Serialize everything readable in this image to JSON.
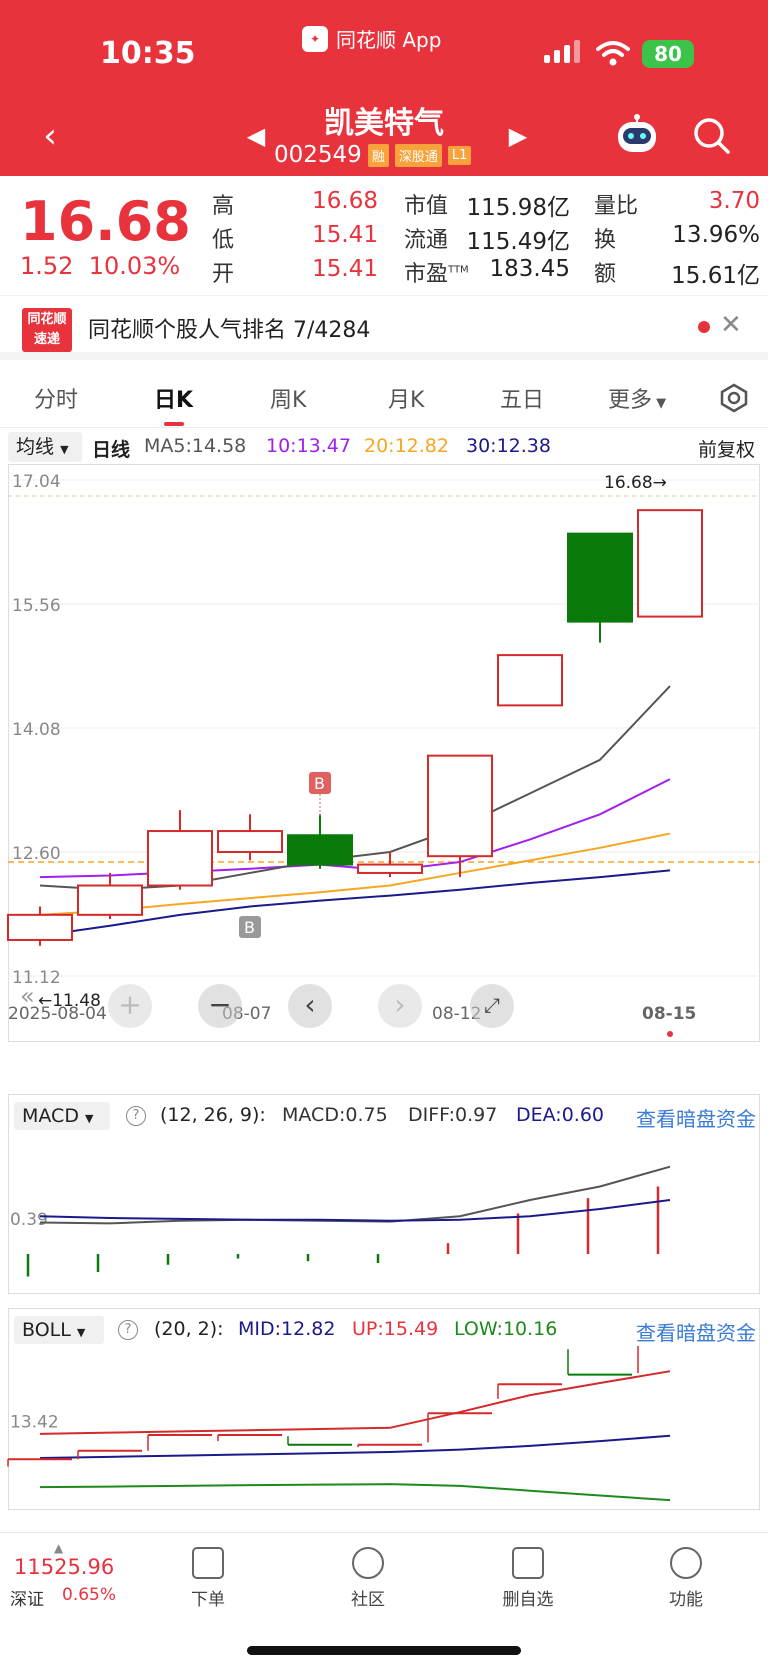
{
  "status": {
    "time": "10:35",
    "app": "同花顺 App",
    "battery": "80"
  },
  "header": {
    "stock_name": "凯美特气",
    "stock_code": "002549",
    "tags": [
      "融",
      "深股通",
      "L1"
    ]
  },
  "quote": {
    "price": "16.68",
    "change": "1.52",
    "change_pct": "10.03%",
    "high_label": "高",
    "high": "16.68",
    "low_label": "低",
    "low": "15.41",
    "open_label": "开",
    "open": "15.41",
    "mcap_label": "市值",
    "mcap": "115.98亿",
    "float_label": "流通",
    "float": "115.49亿",
    "pe_label": "市盈",
    "pe_sup": "TTM",
    "pe": "183.45",
    "vr_label": "量比",
    "vr": "3.70",
    "turnover_label": "换",
    "turnover": "13.96%",
    "amount_label": "额",
    "amount": "15.61亿"
  },
  "ranking": {
    "logo_top": "同花顺",
    "logo_bottom": "速递",
    "text": "同花顺个股人气排名 7/4284"
  },
  "tabs": [
    "分时",
    "日K",
    "周K",
    "月K",
    "五日",
    "更多"
  ],
  "ma_row": {
    "select": "均线",
    "period": "日线",
    "ma5": "MA5:14.58",
    "ma10": "10:13.47",
    "ma20": "20:12.82",
    "ma30": "30:12.38",
    "adjust": "前复权",
    "colors": {
      "ma5": "#555555",
      "ma10": "#a020f0",
      "ma20": "#f5a623",
      "ma30": "#1a1a8c"
    }
  },
  "kline": {
    "y_labels": [
      "17.04",
      "15.56",
      "14.08",
      "12.60",
      "11.12"
    ],
    "ymin": 11.12,
    "ymax": 17.04,
    "x_labels": [
      "2025-08-04",
      "08-07",
      "08-12",
      "08-15"
    ],
    "high_marker": "16.68→",
    "low_marker": "←11.48",
    "b_marker": "B",
    "current_price_line": 12.48
  },
  "chart_data": {
    "type": "candlestick",
    "dates": [
      "08-04",
      "08-05",
      "08-06",
      "08-07",
      "08-08",
      "08-11",
      "08-12",
      "08-13",
      "08-14",
      "08-15"
    ],
    "candles": [
      {
        "open": 11.55,
        "close": 11.85,
        "high": 11.95,
        "low": 11.48
      },
      {
        "open": 11.85,
        "close": 12.2,
        "high": 12.35,
        "low": 11.8
      },
      {
        "open": 12.2,
        "close": 12.85,
        "high": 13.1,
        "low": 12.15
      },
      {
        "open": 12.6,
        "close": 12.85,
        "high": 13.05,
        "low": 12.5
      },
      {
        "open": 12.8,
        "close": 12.45,
        "high": 13.05,
        "low": 12.4
      },
      {
        "open": 12.35,
        "close": 12.45,
        "high": 12.6,
        "low": 12.3
      },
      {
        "open": 12.55,
        "close": 13.75,
        "high": 13.75,
        "low": 12.3
      },
      {
        "open": 14.35,
        "close": 14.95,
        "high": 14.95,
        "low": 14.35
      },
      {
        "open": 16.4,
        "close": 15.35,
        "high": 16.4,
        "low": 15.1
      },
      {
        "open": 15.41,
        "close": 16.68,
        "high": 16.68,
        "low": 15.41
      }
    ],
    "ma": {
      "MA5": [
        12.2,
        12.15,
        12.2,
        12.35,
        12.5,
        12.6,
        12.9,
        13.3,
        13.7,
        14.58
      ],
      "MA10": [
        12.3,
        12.32,
        12.36,
        12.4,
        12.45,
        12.38,
        12.48,
        12.75,
        13.05,
        13.47
      ],
      "MA20": [
        11.85,
        11.9,
        11.98,
        12.05,
        12.12,
        12.2,
        12.35,
        12.5,
        12.65,
        12.82
      ],
      "MA30": [
        11.6,
        11.72,
        11.85,
        11.95,
        12.02,
        12.08,
        12.15,
        12.23,
        12.3,
        12.38
      ]
    }
  },
  "macd": {
    "select": "MACD",
    "params": "(12, 26, 9):",
    "macd": "MACD:0.75",
    "diff": "DIFF:0.97",
    "dea": "DEA:0.60",
    "link": "查看暗盘资金",
    "y_label": "0.39",
    "hist": [
      -0.25,
      -0.2,
      -0.12,
      -0.05,
      -0.08,
      -0.1,
      0.12,
      0.45,
      0.62,
      0.75
    ],
    "diff_series": [
      0.35,
      0.34,
      0.37,
      0.38,
      0.37,
      0.36,
      0.42,
      0.6,
      0.75,
      0.97
    ],
    "dea_series": [
      0.42,
      0.4,
      0.39,
      0.38,
      0.38,
      0.37,
      0.38,
      0.42,
      0.5,
      0.6
    ]
  },
  "boll": {
    "select": "BOLL",
    "params": "(20, 2):",
    "mid": "MID:12.82",
    "up": "UP:15.49",
    "low": "LOW:10.16",
    "link": "查看暗盘资金",
    "y_label": "13.42",
    "mid_series": [
      11.9,
      11.95,
      12.0,
      12.05,
      12.1,
      12.15,
      12.25,
      12.4,
      12.6,
      12.82
    ],
    "up_series": [
      12.9,
      12.95,
      13.0,
      13.05,
      13.1,
      13.15,
      13.8,
      14.5,
      15.0,
      15.49
    ],
    "low_series": [
      10.7,
      10.72,
      10.75,
      10.78,
      10.8,
      10.82,
      10.75,
      10.55,
      10.35,
      10.16
    ]
  },
  "bottom": {
    "index_value": "11525.96",
    "index_name": "深证",
    "index_pct": "0.65%",
    "items": [
      "下单",
      "社区",
      "删自选",
      "功能"
    ]
  }
}
